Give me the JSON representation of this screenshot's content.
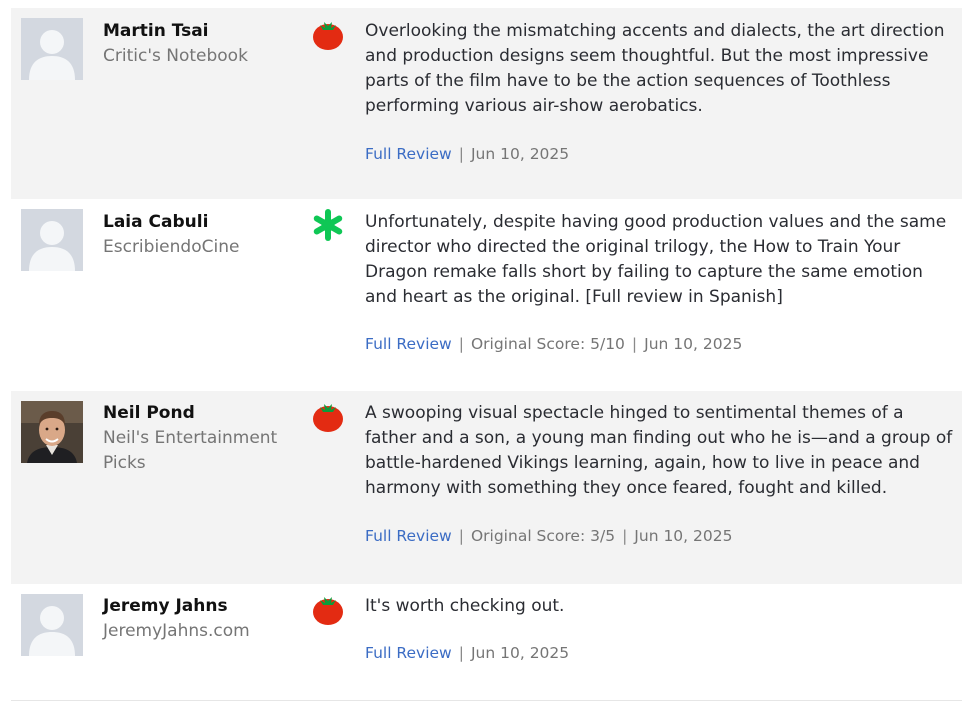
{
  "reviews": [
    {
      "name": "Martin Tsai",
      "publication": "Critic's Notebook",
      "score_icon": "fresh-tomato-icon",
      "quote": "Overlooking the mismatching accents and dialects, the art direction and production designs seem thoughtful. But the most impressive parts of the film have to be the action sequences of Toothless performing various air-show aerobatics.",
      "full_review_label": "Full Review",
      "original_score": "",
      "date": "Jun 10, 2025"
    },
    {
      "name": "Laia Cabuli",
      "publication": "EscribiendoCine",
      "score_icon": "rotten-splat-icon",
      "quote": "Unfortunately, despite having good production values and the same director who directed the original trilogy, the How to Train Your Dragon remake falls short by failing to capture the same emotion and heart as the original. [Full review in Spanish]",
      "full_review_label": "Full Review",
      "original_score": "Original Score: 5/10",
      "date": "Jun 10, 2025"
    },
    {
      "name": "Neil Pond",
      "publication": "Neil's Entertainment Picks",
      "score_icon": "fresh-tomato-icon",
      "quote": "A swooping visual spectacle hinged to sentimental themes of a father and a son, a young man finding out who he is—and a group of battle-hardened Vikings learning, again, how to live in peace and harmony with something they once feared, fought and killed.",
      "full_review_label": "Full Review",
      "original_score": "Original Score: 3/5",
      "date": "Jun 10, 2025"
    },
    {
      "name": "Jeremy Jahns",
      "publication": "JeremyJahns.com",
      "score_icon": "fresh-tomato-icon",
      "quote": "It's worth checking out.",
      "full_review_label": "Full Review",
      "original_score": "",
      "date": "Jun 10, 2025"
    }
  ],
  "colors": {
    "row_shade": "#f3f3f3",
    "link": "#3b6cc4",
    "tomato_red": "#e32b12",
    "splat_green": "#0fc755"
  }
}
